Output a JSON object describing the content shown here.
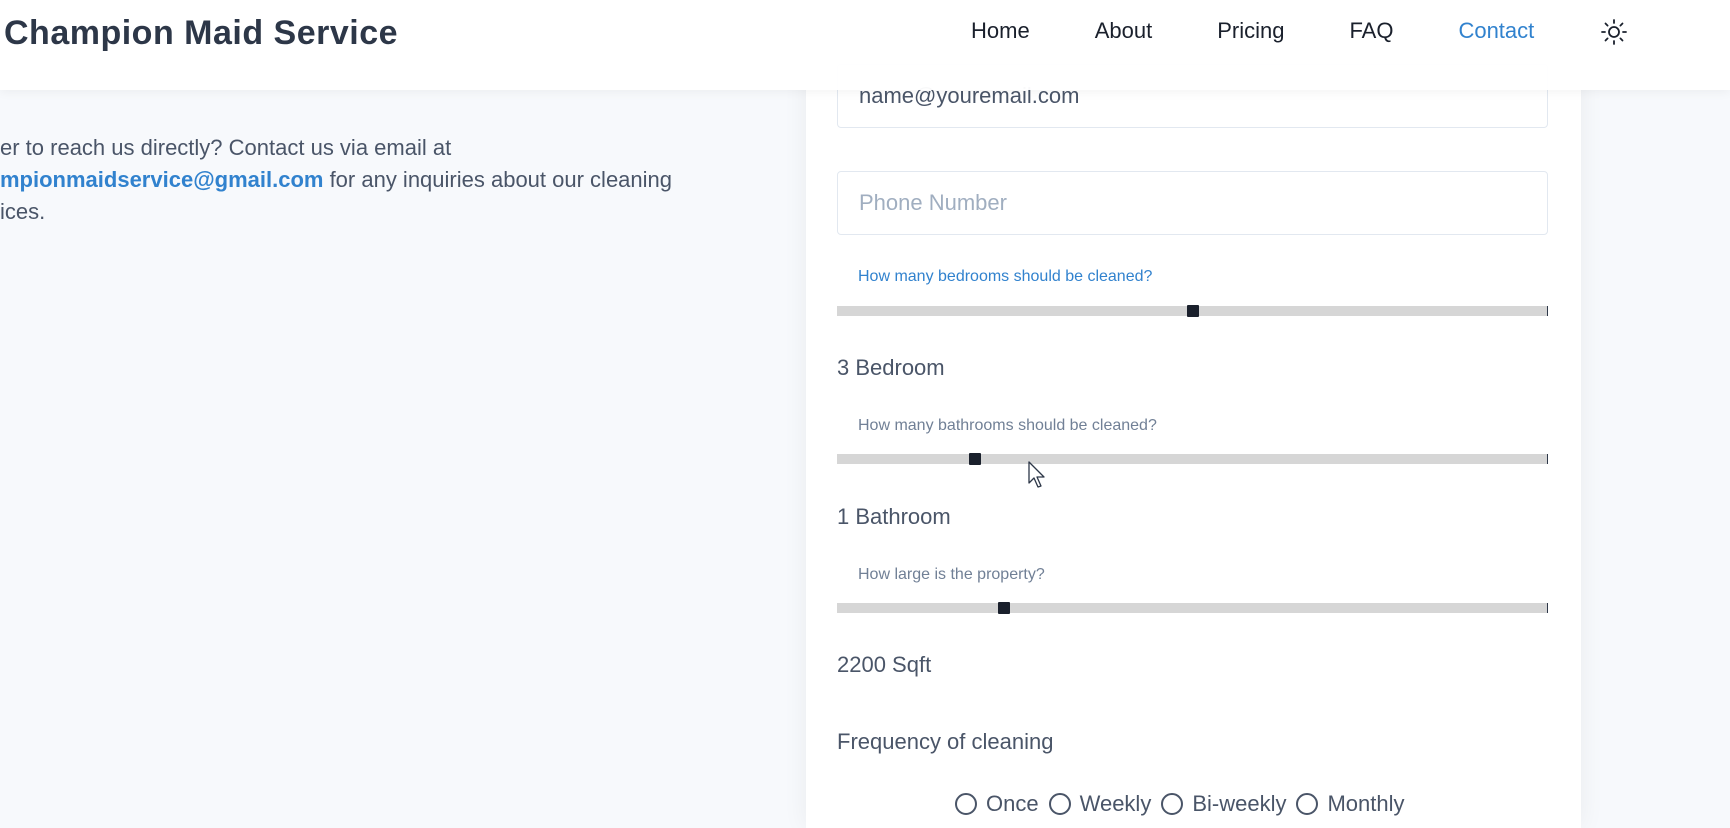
{
  "header": {
    "brand": "Champion Maid Service",
    "nav": [
      "Home",
      "About",
      "Pricing",
      "FAQ",
      "Contact"
    ],
    "active_nav": "Contact",
    "theme_icon": "sun-icon"
  },
  "intro": {
    "line1": "er to reach us directly? Contact us via email at",
    "email": "mpionmaidservice@gmail.com",
    "line2_rest": " for any inquiries about our cleaning",
    "line3": "ices."
  },
  "form": {
    "email_value": "name@youremail.com",
    "phone_placeholder": "Phone Number",
    "bedrooms": {
      "question": "How many bedrooms should be cleaned?",
      "value_text": "3 Bedroom",
      "fraction": 0.5
    },
    "bathrooms": {
      "question": "How many bathrooms should be cleaned?",
      "value_text": "1 Bathroom",
      "fraction": 0.194
    },
    "property": {
      "question": "How large is the property?",
      "value_text": "2200 Sqft",
      "fraction": 0.235
    },
    "frequency": {
      "label": "Frequency of cleaning",
      "options": [
        "Once",
        "Weekly",
        "Bi-weekly",
        "Monthly"
      ]
    }
  },
  "colors": {
    "accent": "#3182ce",
    "text": "#2d3748",
    "track": "#d6d6d6"
  }
}
